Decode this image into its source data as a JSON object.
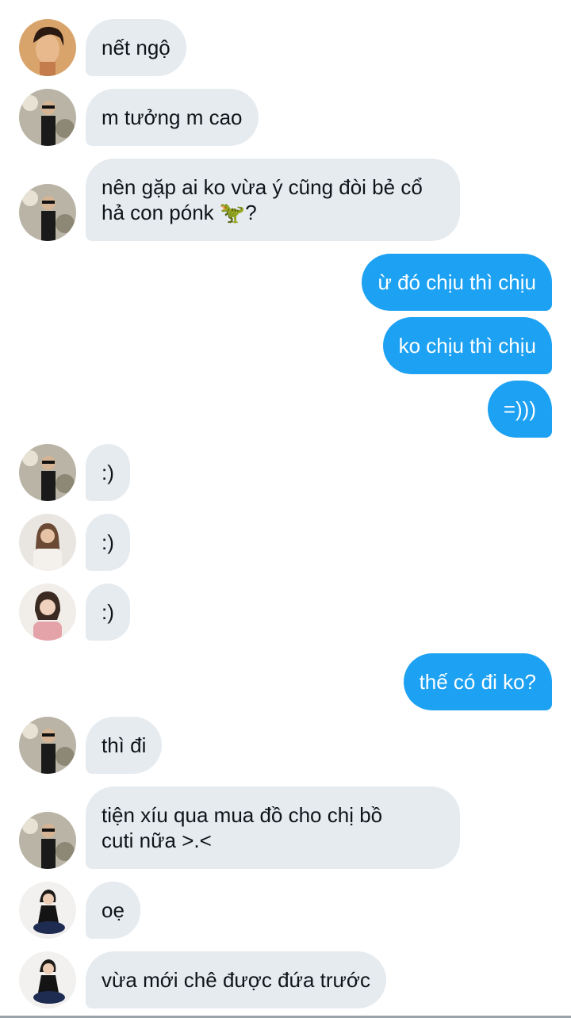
{
  "messages": [
    {
      "side": "in",
      "avatar": "woman-portrait-1",
      "text": "nết ngộ"
    },
    {
      "side": "in",
      "avatar": "man-sunglasses",
      "text": "m tưởng m cao"
    },
    {
      "side": "in",
      "avatar": "man-sunglasses",
      "text": "nên gặp ai ko vừa ý cũng đòi bẻ cổ\nhả con pónk 🦖?"
    },
    {
      "side": "out",
      "text": "ừ đó chịu thì chịu"
    },
    {
      "side": "out",
      "text": "ko chịu thì chịu"
    },
    {
      "side": "out",
      "text": "=)))"
    },
    {
      "side": "in",
      "avatar": "man-sunglasses",
      "text": ":)"
    },
    {
      "side": "in",
      "avatar": "woman-white-sweater",
      "text": ":)"
    },
    {
      "side": "in",
      "avatar": "woman-pink-top",
      "text": ":)"
    },
    {
      "side": "out",
      "text": "thế có đi ko?"
    },
    {
      "side": "in",
      "avatar": "man-sunglasses",
      "text": "thì đi"
    },
    {
      "side": "in",
      "avatar": "man-sunglasses",
      "text": "tiện xíu qua mua đồ cho chị bồ\ncuti nữa >.<"
    },
    {
      "side": "in",
      "avatar": "woman-black-dress",
      "text": "oẹ"
    },
    {
      "side": "in",
      "avatar": "woman-black-dress",
      "text": "vừa mới chê được đứa trước"
    }
  ],
  "colors": {
    "incoming_bubble": "#e6ebf0",
    "outgoing_bubble": "#1da1f2",
    "incoming_text": "#0f1419",
    "outgoing_text": "#ffffff"
  }
}
